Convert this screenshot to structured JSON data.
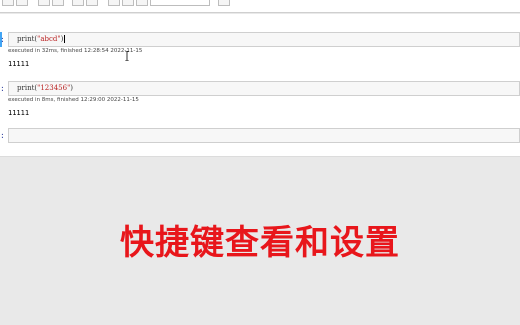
{
  "cells": [
    {
      "prompt": ":",
      "code_fn": "print(",
      "code_str": "\"abcd\"",
      "code_close": ")",
      "exec_info": "executed in 32ms, finished 12:28:54 2022-11-15",
      "output": "11111"
    },
    {
      "prompt": ":",
      "code_fn": "print(",
      "code_str": "\"123456\"",
      "code_close": ")",
      "exec_info": "executed in 8ms, finished 12:29:00 2022-11-15",
      "output": "11111"
    },
    {
      "prompt": ":"
    }
  ],
  "caption": "快捷键查看和设置",
  "colors": {
    "caption": "#e8161b",
    "prompt": "#303f9f",
    "string": "#ba2121",
    "selected": "#42a5f5"
  }
}
